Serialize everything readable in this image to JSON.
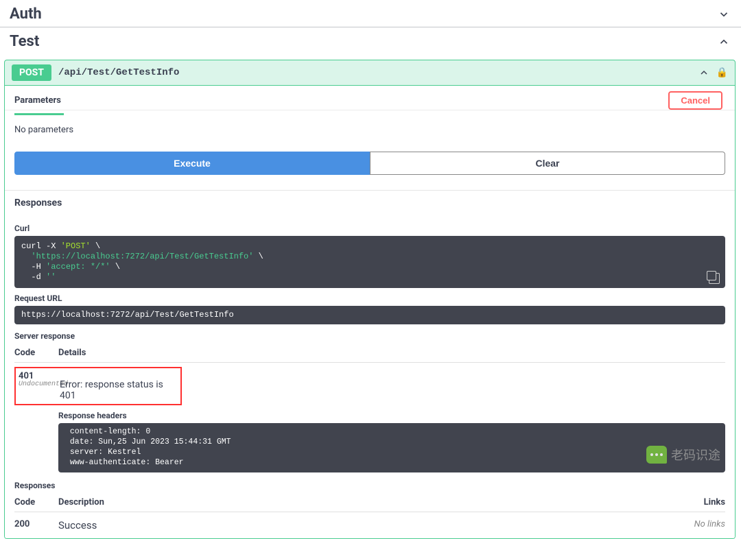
{
  "sections": {
    "auth": "Auth",
    "test": "Test"
  },
  "endpoint": {
    "method": "POST",
    "path": "/api/Test/GetTestInfo"
  },
  "tabs": {
    "parameters": "Parameters",
    "cancel": "Cancel"
  },
  "body": {
    "no_params": "No parameters",
    "execute": "Execute",
    "clear": "Clear"
  },
  "responses": {
    "title": "Responses",
    "curl_label": "Curl",
    "curl_l1_a": "curl -X ",
    "curl_l1_b": "'POST'",
    "curl_l1_c": " \\",
    "curl_l2_a": "  ",
    "curl_l2_b": "'https://localhost:7272/api/Test/GetTestInfo'",
    "curl_l2_c": " \\",
    "curl_l3_a": "  -H ",
    "curl_l3_b": "'accept: */*'",
    "curl_l3_c": " \\",
    "curl_l4_a": "  -d ",
    "curl_l4_b": "''",
    "request_url_label": "Request URL",
    "request_url": "https://localhost:7272/api/Test/GetTestInfo",
    "server_response_label": "Server response",
    "code_h": "Code",
    "details_h": "Details",
    "code_val": "401",
    "undocumented": "Undocumented",
    "error_msg": "Error: response status is 401",
    "resp_headers_label": "Response headers",
    "hdr1": " content-length: 0 ",
    "hdr2": " date: Sun,25 Jun 2023 15:44:31 GMT ",
    "hdr3": " server: Kestrel ",
    "hdr4": " www-authenticate: Bearer "
  },
  "responses2": {
    "title": "Responses",
    "code_h": "Code",
    "desc_h": "Description",
    "links_h": "Links",
    "row_code": "200",
    "row_desc": "Success",
    "no_links": "No links"
  },
  "watermark": "老码识途"
}
